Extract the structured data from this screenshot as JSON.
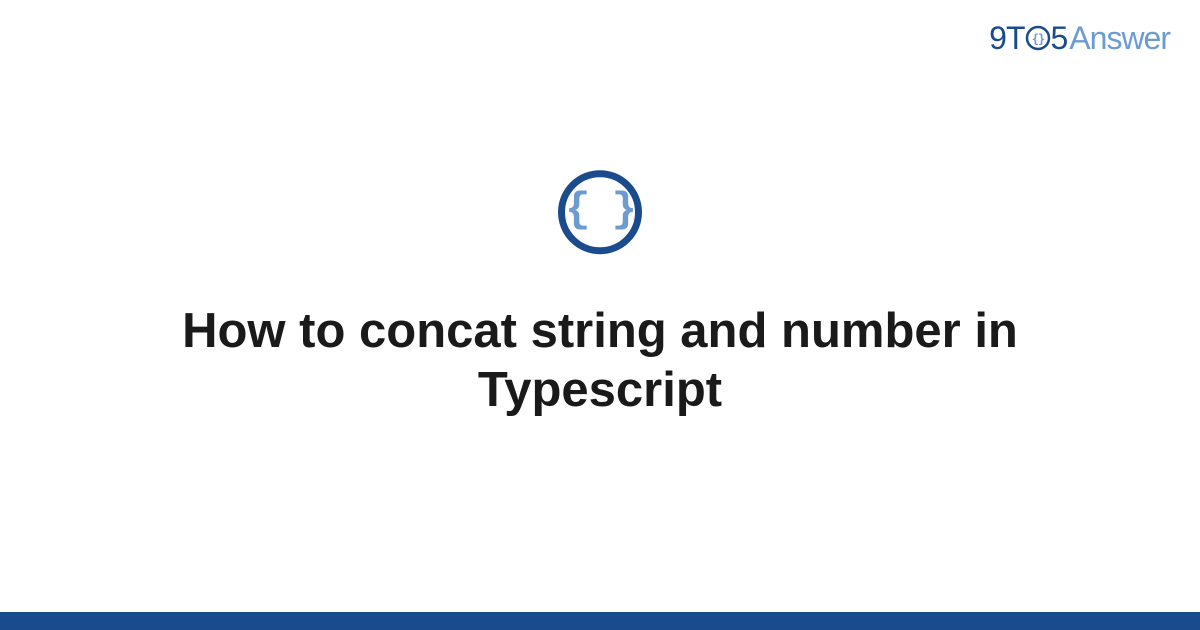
{
  "logo": {
    "nine": "9",
    "t": "T",
    "five": "5",
    "answer": "Answer"
  },
  "icon": {
    "braces": "{ }",
    "name": "code-braces-icon"
  },
  "main": {
    "title": "How to concat string and number in Typescript"
  },
  "colors": {
    "primary": "#1a4b8c",
    "accent": "#6b9bd1"
  }
}
